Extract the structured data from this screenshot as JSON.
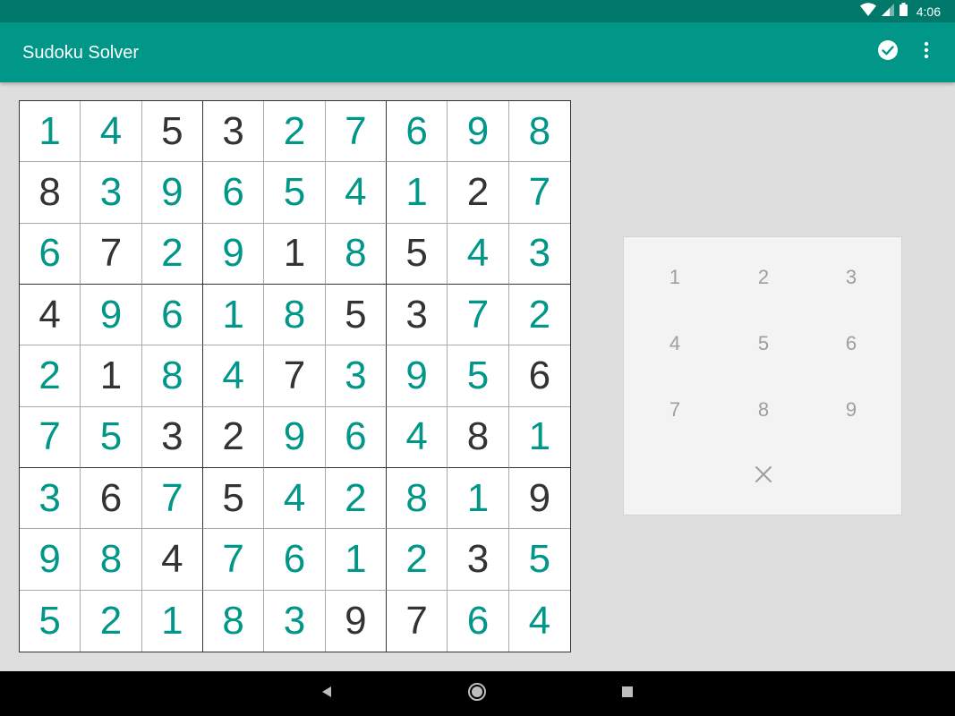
{
  "status_bar": {
    "time": "4:06"
  },
  "app_bar": {
    "title": "Sudoku Solver",
    "actions": [
      {
        "icon": "check-circle-icon"
      },
      {
        "icon": "more-vert-icon"
      }
    ]
  },
  "board": {
    "rows": [
      [
        {
          "v": "1",
          "s": true
        },
        {
          "v": "4",
          "s": true
        },
        {
          "v": "5",
          "s": false
        },
        {
          "v": "3",
          "s": false
        },
        {
          "v": "2",
          "s": true
        },
        {
          "v": "7",
          "s": true
        },
        {
          "v": "6",
          "s": true
        },
        {
          "v": "9",
          "s": true
        },
        {
          "v": "8",
          "s": true
        }
      ],
      [
        {
          "v": "8",
          "s": false
        },
        {
          "v": "3",
          "s": true
        },
        {
          "v": "9",
          "s": true
        },
        {
          "v": "6",
          "s": true
        },
        {
          "v": "5",
          "s": true
        },
        {
          "v": "4",
          "s": true
        },
        {
          "v": "1",
          "s": true
        },
        {
          "v": "2",
          "s": false
        },
        {
          "v": "7",
          "s": true
        }
      ],
      [
        {
          "v": "6",
          "s": true
        },
        {
          "v": "7",
          "s": false
        },
        {
          "v": "2",
          "s": true
        },
        {
          "v": "9",
          "s": true
        },
        {
          "v": "1",
          "s": false
        },
        {
          "v": "8",
          "s": true
        },
        {
          "v": "5",
          "s": false
        },
        {
          "v": "4",
          "s": true
        },
        {
          "v": "3",
          "s": true
        }
      ],
      [
        {
          "v": "4",
          "s": false
        },
        {
          "v": "9",
          "s": true
        },
        {
          "v": "6",
          "s": true
        },
        {
          "v": "1",
          "s": true
        },
        {
          "v": "8",
          "s": true
        },
        {
          "v": "5",
          "s": false
        },
        {
          "v": "3",
          "s": false
        },
        {
          "v": "7",
          "s": true
        },
        {
          "v": "2",
          "s": true
        }
      ],
      [
        {
          "v": "2",
          "s": true
        },
        {
          "v": "1",
          "s": false
        },
        {
          "v": "8",
          "s": true
        },
        {
          "v": "4",
          "s": true
        },
        {
          "v": "7",
          "s": false
        },
        {
          "v": "3",
          "s": true
        },
        {
          "v": "9",
          "s": true
        },
        {
          "v": "5",
          "s": true
        },
        {
          "v": "6",
          "s": false
        }
      ],
      [
        {
          "v": "7",
          "s": true
        },
        {
          "v": "5",
          "s": true
        },
        {
          "v": "3",
          "s": false
        },
        {
          "v": "2",
          "s": false
        },
        {
          "v": "9",
          "s": true
        },
        {
          "v": "6",
          "s": true
        },
        {
          "v": "4",
          "s": true
        },
        {
          "v": "8",
          "s": false
        },
        {
          "v": "1",
          "s": true
        }
      ],
      [
        {
          "v": "3",
          "s": true
        },
        {
          "v": "6",
          "s": false
        },
        {
          "v": "7",
          "s": true
        },
        {
          "v": "5",
          "s": false
        },
        {
          "v": "4",
          "s": true
        },
        {
          "v": "2",
          "s": true
        },
        {
          "v": "8",
          "s": true
        },
        {
          "v": "1",
          "s": true
        },
        {
          "v": "9",
          "s": false
        }
      ],
      [
        {
          "v": "9",
          "s": true
        },
        {
          "v": "8",
          "s": true
        },
        {
          "v": "4",
          "s": false
        },
        {
          "v": "7",
          "s": true
        },
        {
          "v": "6",
          "s": true
        },
        {
          "v": "1",
          "s": true
        },
        {
          "v": "2",
          "s": true
        },
        {
          "v": "3",
          "s": false
        },
        {
          "v": "5",
          "s": true
        }
      ],
      [
        {
          "v": "5",
          "s": true
        },
        {
          "v": "2",
          "s": true
        },
        {
          "v": "1",
          "s": true
        },
        {
          "v": "8",
          "s": true
        },
        {
          "v": "3",
          "s": true
        },
        {
          "v": "9",
          "s": false
        },
        {
          "v": "7",
          "s": false
        },
        {
          "v": "6",
          "s": true
        },
        {
          "v": "4",
          "s": true
        }
      ]
    ]
  },
  "numpad": {
    "keys": [
      "1",
      "2",
      "3",
      "4",
      "5",
      "6",
      "7",
      "8",
      "9"
    ],
    "clear_icon": "close-icon"
  },
  "nav_bar": {
    "buttons": [
      "back-icon",
      "home-icon",
      "recents-icon"
    ]
  },
  "colors": {
    "status_bar": "#00796b",
    "app_bar": "#009688",
    "solved_digit": "#009688",
    "given_digit": "#333333",
    "numpad_key": "#9e9e9e",
    "background": "#dedede"
  }
}
